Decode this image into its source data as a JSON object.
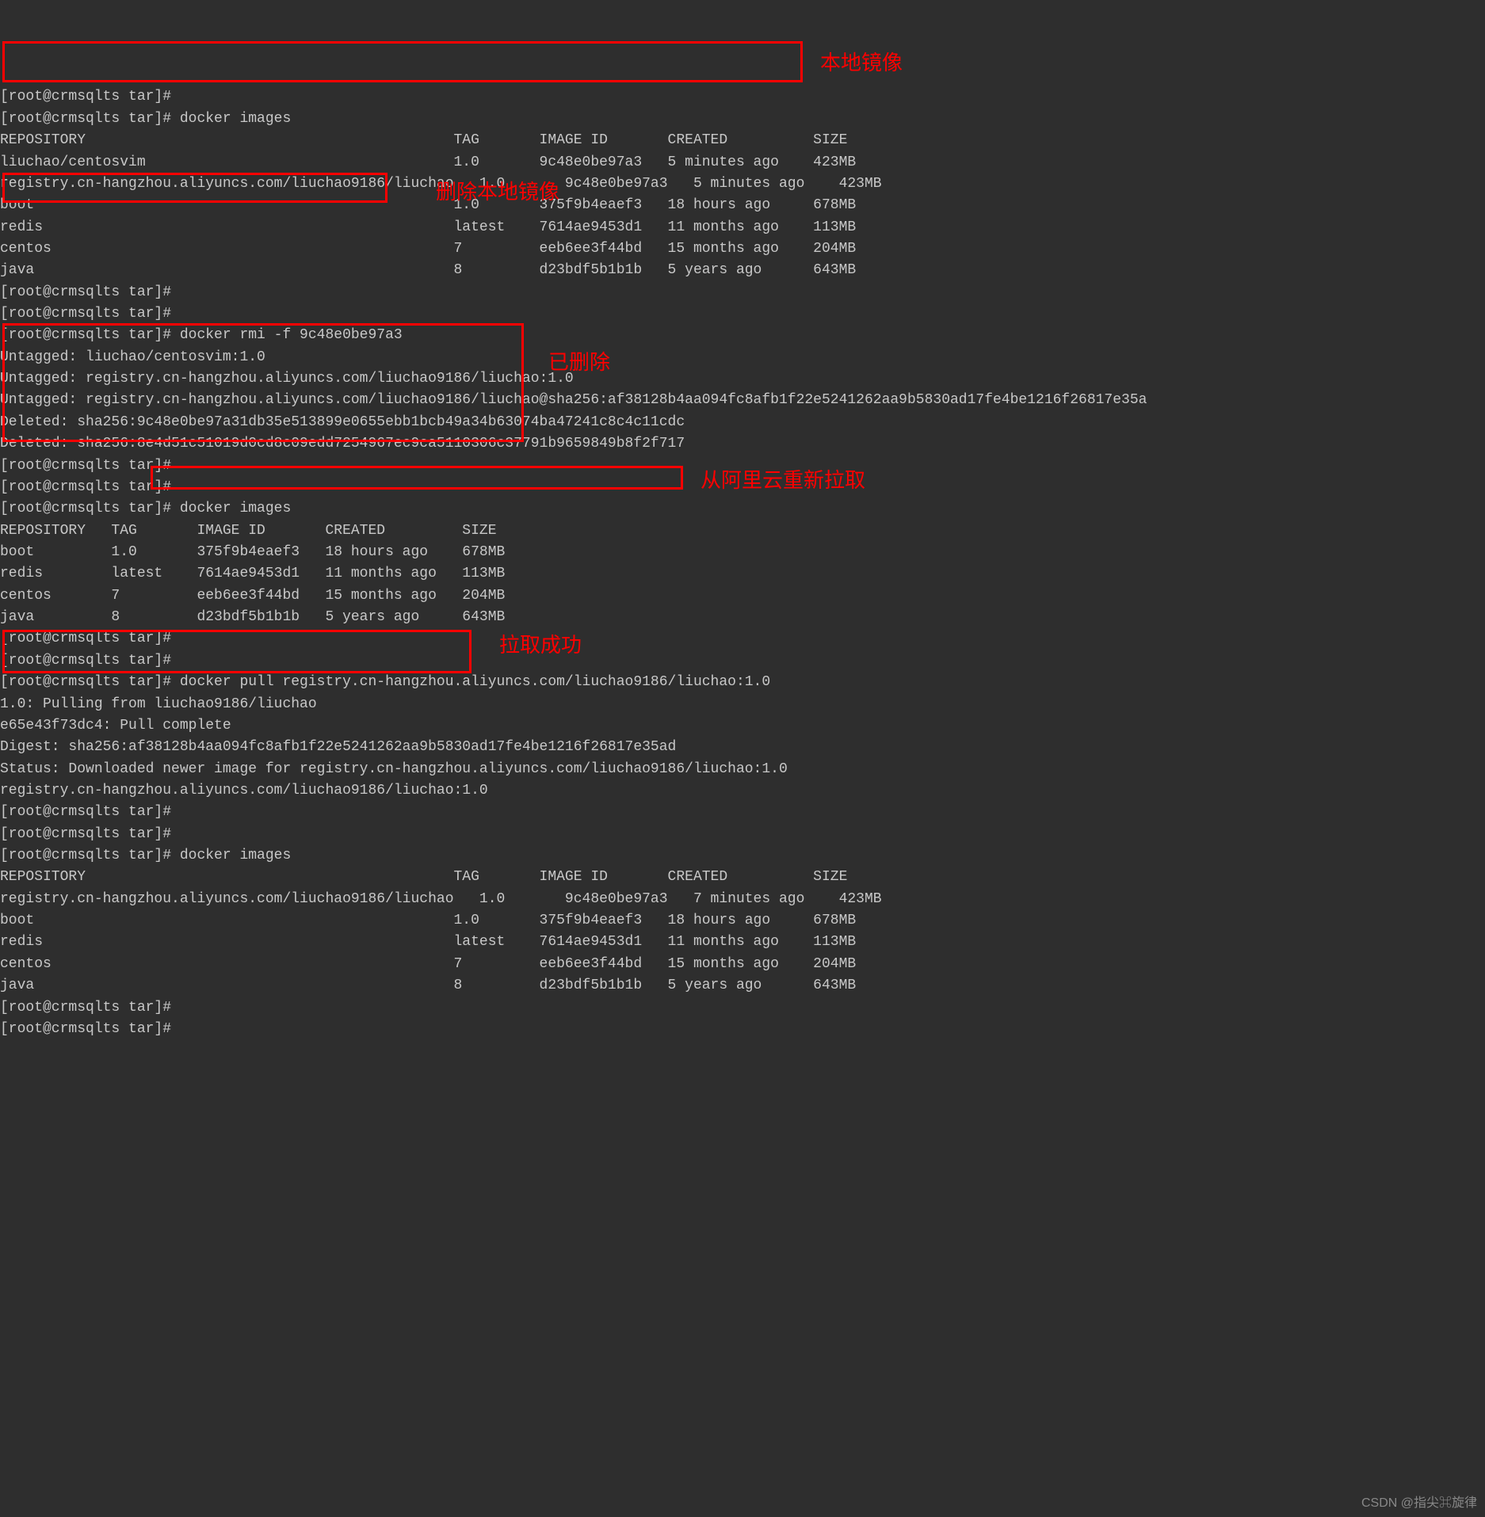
{
  "lines": [
    "[root@crmsqlts tar]#",
    "[root@crmsqlts tar]# docker images",
    "REPOSITORY                                           TAG       IMAGE ID       CREATED          SIZE",
    "liuchao/centosvim                                    1.0       9c48e0be97a3   5 minutes ago    423MB",
    "registry.cn-hangzhou.aliyuncs.com/liuchao9186/liuchao   1.0       9c48e0be97a3   5 minutes ago    423MB",
    "boot                                                 1.0       375f9b4eaef3   18 hours ago     678MB",
    "redis                                                latest    7614ae9453d1   11 months ago    113MB",
    "centos                                               7         eeb6ee3f44bd   15 months ago    204MB",
    "java                                                 8         d23bdf5b1b1b   5 years ago      643MB",
    "[root@crmsqlts tar]#",
    "[root@crmsqlts tar]#",
    "[root@crmsqlts tar]# docker rmi -f 9c48e0be97a3",
    "Untagged: liuchao/centosvim:1.0",
    "Untagged: registry.cn-hangzhou.aliyuncs.com/liuchao9186/liuchao:1.0",
    "Untagged: registry.cn-hangzhou.aliyuncs.com/liuchao9186/liuchao@sha256:af38128b4aa094fc8afb1f22e5241262aa9b5830ad17fe4be1216f26817e35a",
    "Deleted: sha256:9c48e0be97a31db35e513899e0655ebb1bcb49a34b63074ba47241c8c4c11cdc",
    "Deleted: sha256:8e4d51c51019d0cd8c09edd7254967ec9ca5110306c37791b9659849b8f2f717",
    "[root@crmsqlts tar]#",
    "[root@crmsqlts tar]#",
    "[root@crmsqlts tar]# docker images",
    "REPOSITORY   TAG       IMAGE ID       CREATED         SIZE",
    "boot         1.0       375f9b4eaef3   18 hours ago    678MB",
    "redis        latest    7614ae9453d1   11 months ago   113MB",
    "centos       7         eeb6ee3f44bd   15 months ago   204MB",
    "java         8         d23bdf5b1b1b   5 years ago     643MB",
    "[root@crmsqlts tar]#",
    "[root@crmsqlts tar]#",
    "[root@crmsqlts tar]# docker pull registry.cn-hangzhou.aliyuncs.com/liuchao9186/liuchao:1.0",
    "1.0: Pulling from liuchao9186/liuchao",
    "e65e43f73dc4: Pull complete",
    "Digest: sha256:af38128b4aa094fc8afb1f22e5241262aa9b5830ad17fe4be1216f26817e35ad",
    "Status: Downloaded newer image for registry.cn-hangzhou.aliyuncs.com/liuchao9186/liuchao:1.0",
    "registry.cn-hangzhou.aliyuncs.com/liuchao9186/liuchao:1.0",
    "[root@crmsqlts tar]#",
    "[root@crmsqlts tar]#",
    "[root@crmsqlts tar]# docker images",
    "REPOSITORY                                           TAG       IMAGE ID       CREATED          SIZE",
    "registry.cn-hangzhou.aliyuncs.com/liuchao9186/liuchao   1.0       9c48e0be97a3   7 minutes ago    423MB",
    "boot                                                 1.0       375f9b4eaef3   18 hours ago     678MB",
    "redis                                                latest    7614ae9453d1   11 months ago    113MB",
    "centos                                               7         eeb6ee3f44bd   15 months ago    204MB",
    "java                                                 8         d23bdf5b1b1b   5 years ago      643MB",
    "[root@crmsqlts tar]#",
    "[root@crmsqlts tar]# "
  ],
  "annotations": {
    "a1": "本地镜像",
    "a2": "删除本地镜像",
    "a3": "已删除",
    "a4": "从阿里云重新拉取",
    "a5": "拉取成功"
  },
  "watermark": "CSDN @指尖⌘旋律"
}
